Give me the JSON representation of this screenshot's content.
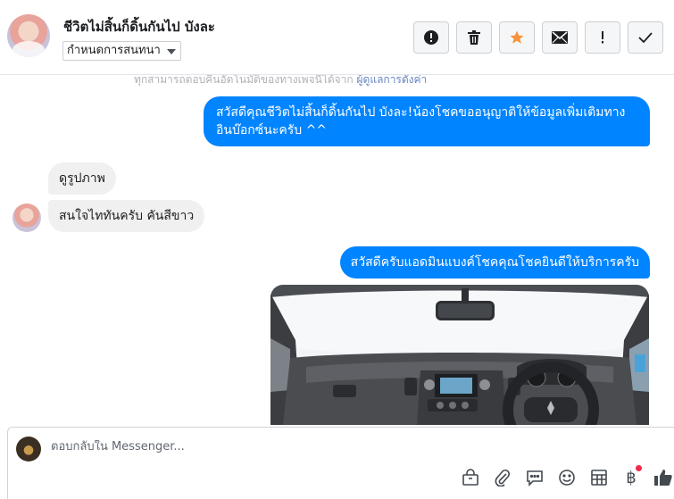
{
  "header": {
    "contact_name": "ชีวิตไม่สิ้นก็ดิ้นกันไป บังละ",
    "define_chat_label": "กำหนดการสนทนา",
    "actions": [
      {
        "name": "spam-button",
        "icon": "alert-circle-icon"
      },
      {
        "name": "delete-button",
        "icon": "trash-icon"
      },
      {
        "name": "star-button",
        "icon": "star-icon",
        "color": "#f7923b"
      },
      {
        "name": "mark-unread-button",
        "icon": "envelope-icon"
      },
      {
        "name": "follow-up-button",
        "icon": "exclamation-icon"
      },
      {
        "name": "mark-done-button",
        "icon": "check-icon"
      }
    ]
  },
  "conversation": {
    "notice_text": "ทุกสามารถตอบคืนอัตโนมัติของทางเพจนี้ได้จาก",
    "notice_link": "ผู้ดูแลการตั้งค่า",
    "messages": [
      {
        "direction": "outgoing",
        "text": "สวัสดีคุณชีวิตไม่สิ้นก็ดิ้นกันไป บังละ!น้องโชคขออนุญาติให้ข้อมูลเพิ่มเติมทางอินบ๊อกซ์นะครับ ^^"
      },
      {
        "direction": "incoming",
        "text": "ดูรูปภาพ"
      },
      {
        "direction": "incoming",
        "text": "สนใจไททันครับ คันสีขาว"
      },
      {
        "direction": "outgoing",
        "text": "สวัสดีครับแอดมินแบงค์โชคคุณโชคยินดีให้บริการครับ"
      }
    ],
    "outgoing_color": "#0084ff",
    "incoming_color": "#f1f0f0"
  },
  "composer": {
    "placeholder": "ตอบกลับใน Messenger...",
    "tools": [
      "bag-icon",
      "paperclip-icon",
      "saved-reply-icon",
      "emoji-icon",
      "table-icon",
      "baht-icon",
      "thumbs-up-icon"
    ],
    "baht_symbol": "฿",
    "notification_dot_color": "#f02849"
  }
}
